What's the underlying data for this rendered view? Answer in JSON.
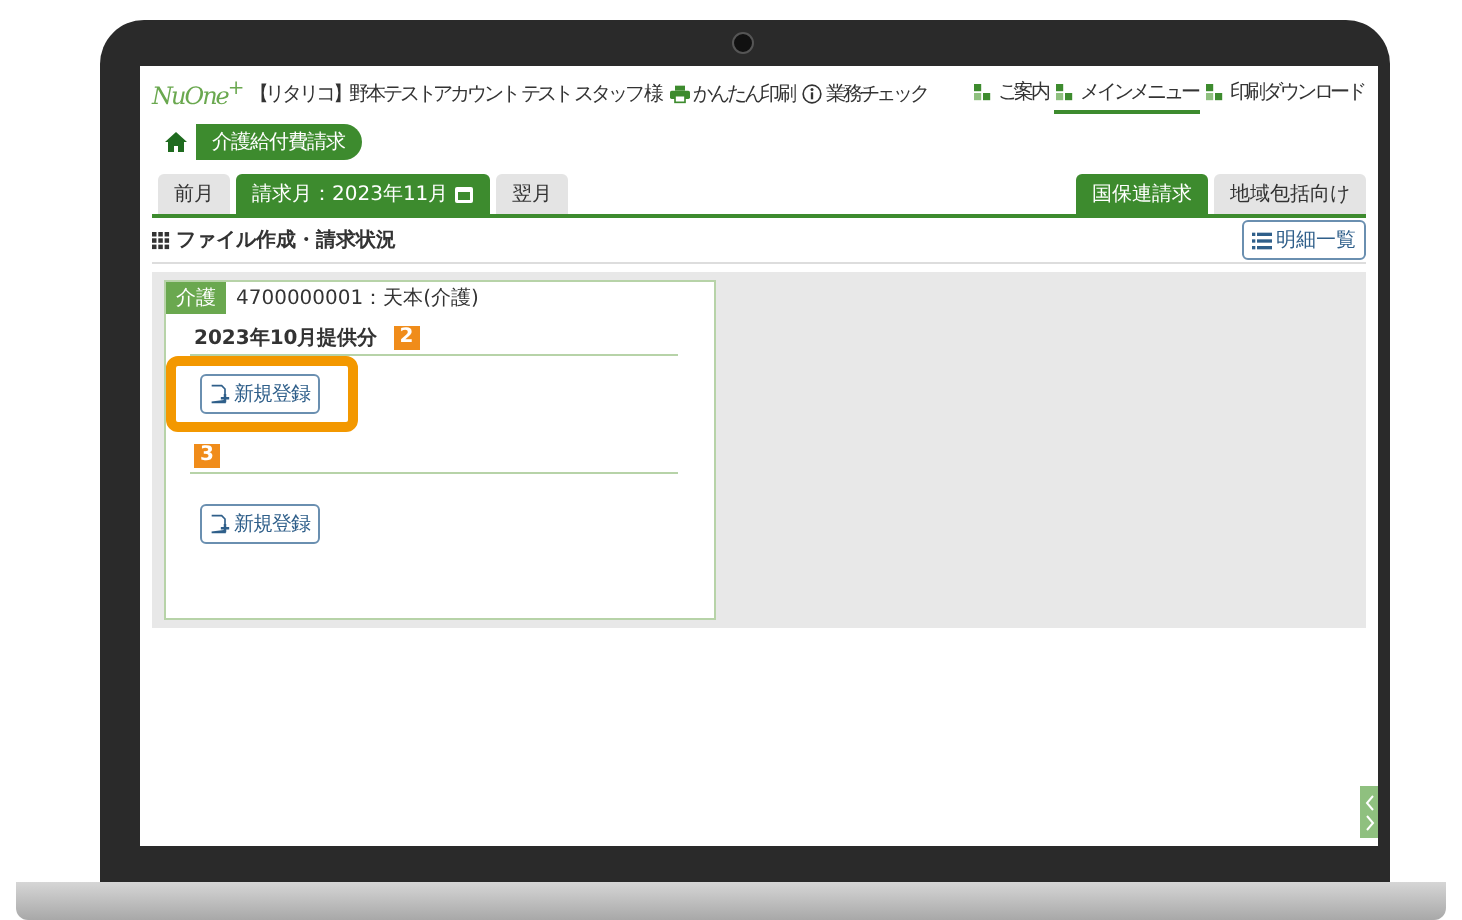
{
  "header": {
    "logo": "NuOne$^{+}$",
    "user": "【リタリコ】野本テストアカウント テスト スタッフ 様",
    "links": [
      "かんたん印刷",
      "業務チェック"
    ],
    "nav": [
      {
        "label": "ご案内",
        "selected": false
      },
      {
        "label": "メインメニュー",
        "selected": true
      },
      {
        "label": "印刷ダウンロード",
        "selected": false
      }
    ]
  },
  "breadcrumb": "介護給付費請求",
  "month_tabs": [
    {
      "label": "前月",
      "selected": false
    },
    {
      "label": "請求月：2023年11月",
      "selected": true
    },
    {
      "label": "翌月",
      "selected": false
    }
  ],
  "type_tabs": [
    {
      "label": "国保連請求",
      "selected": true
    },
    {
      "label": "地域包括向け",
      "selected": false
    }
  ],
  "section_title": "ファイル作成・請求状況",
  "detail_button": "明細一覧",
  "card": {
    "tag": "介護",
    "office": "4700000001：天本(介護)",
    "groups": [
      {
        "title": "2023年10月提供分",
        "badge": "2",
        "button": "新規登録",
        "highlighted": true
      },
      {
        "badge": "3",
        "button": "新規登録",
        "highlighted": false
      }
    ]
  }
}
